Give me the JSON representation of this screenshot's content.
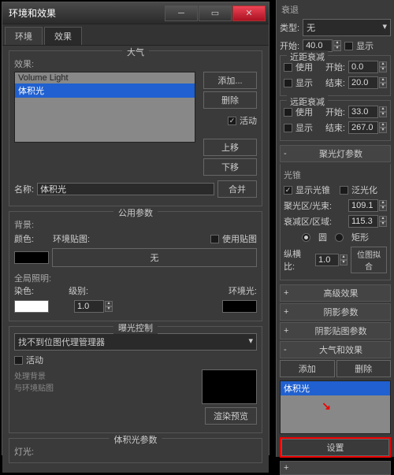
{
  "main": {
    "title": "环境和效果",
    "tabs": [
      "环境",
      "效果"
    ],
    "atmosphere": {
      "title": "大气",
      "effects_label": "效果:",
      "items": [
        "Volume Light",
        "体积光"
      ],
      "add": "添加...",
      "del": "删除",
      "active": "活动",
      "up": "上移",
      "down": "下移",
      "name_label": "名称:",
      "name_value": "体积光",
      "merge": "合并"
    },
    "common": {
      "title": "公用参数",
      "bg_label": "背景:",
      "color_label": "颜色:",
      "envmap_label": "环境贴图:",
      "usemap": "使用贴图",
      "none": "无",
      "global_label": "全局照明:",
      "tint": "染色:",
      "level": "级别:",
      "level_value": "1.0",
      "ambient": "环境光:"
    },
    "exposure": {
      "title": "曝光控制",
      "dropdown": "找不到位图代理管理器",
      "active": "活动",
      "proc_bg": "处理背景\n与环境贴图",
      "render_preview": "渲染预览"
    },
    "vol_title": "体积光参数",
    "lights_label": "灯光:"
  },
  "side": {
    "decay_label": "衰退",
    "type_label": "类型:",
    "type_value": "无",
    "start_label": "开始:",
    "start_value": "40.0",
    "show": "显示",
    "near": {
      "title": "近距衰减",
      "use": "使用",
      "start": "开始:",
      "start_v": "0.0",
      "end": "结束:",
      "end_v": "20.0"
    },
    "far": {
      "title": "远距衰减",
      "use": "使用",
      "start": "开始:",
      "start_v": "33.0",
      "end": "结束:",
      "end_v": "267.0"
    },
    "spot": {
      "title": "聚光灯参数",
      "cone": "光锥",
      "showcone": "显示光锥",
      "overshoot": "泛光化",
      "hotspot": "聚光区/光束:",
      "hotspot_v": "109.1",
      "falloff": "衰减区/区域:",
      "falloff_v": "115.3",
      "circle": "圆",
      "rect": "矩形",
      "aspect": "纵横比:",
      "aspect_v": "1.0",
      "bitmap": "位图拟合"
    },
    "rollouts": [
      "高级效果",
      "阴影参数",
      "阴影贴图参数"
    ],
    "atmo": {
      "title": "大气和效果",
      "add": "添加",
      "del": "删除",
      "item": "体积光",
      "setup": "设置"
    }
  }
}
